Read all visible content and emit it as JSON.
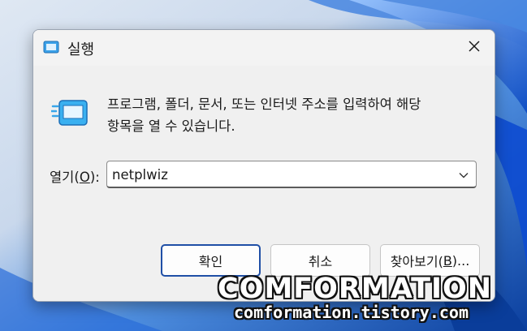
{
  "window": {
    "title": "실행",
    "icon": "run-icon",
    "close_icon": "close-icon"
  },
  "content": {
    "description": "프로그램, 폴더, 문서, 또는 인터넷 주소를 입력하여 해당\n항목을 열 수 있습니다.",
    "open_label_prefix": "열기(",
    "open_label_access_key": "O",
    "open_label_suffix": "):",
    "input_value": "netplwiz",
    "dropdown_icon": "chevron-down-icon"
  },
  "buttons": {
    "ok": "확인",
    "cancel": "취소",
    "browse_prefix": "찾아보기(",
    "browse_access_key": "B",
    "browse_suffix": ")..."
  },
  "watermark": {
    "title": "COMFORMATION",
    "url": "comformation.tistory.com"
  },
  "colors": {
    "wallpaper_blue": "#1a5fc4",
    "primary_border": "#1f4fa6",
    "dialog_background": "#f0f0f0"
  }
}
